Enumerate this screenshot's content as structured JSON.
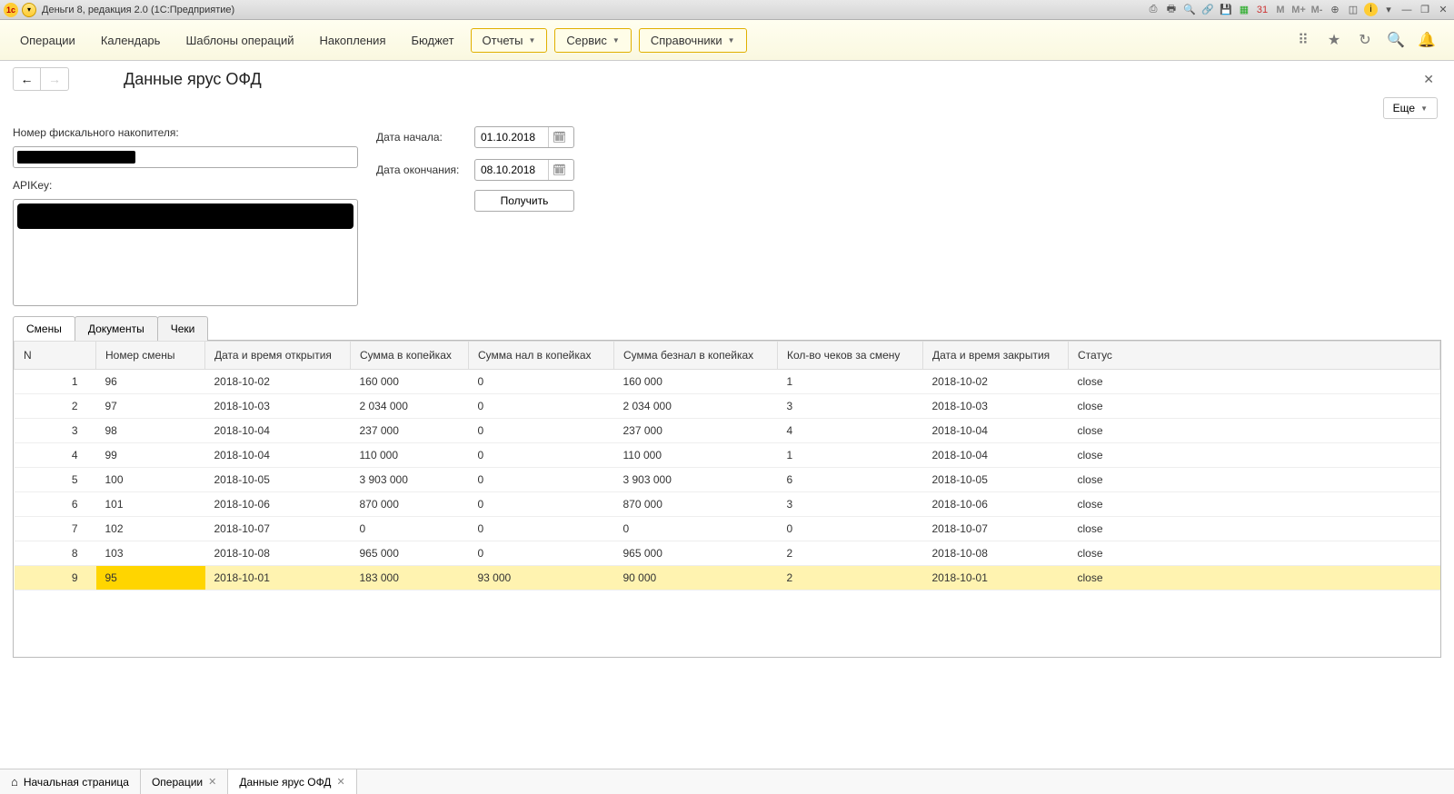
{
  "window_title": "Деньги 8, редакция 2.0  (1С:Предприятие)",
  "titlebar_icons": [
    "M",
    "M+",
    "M-"
  ],
  "menu": {
    "items": [
      "Операции",
      "Календарь",
      "Шаблоны операций",
      "Накопления",
      "Бюджет"
    ],
    "buttons": [
      "Отчеты",
      "Сервис",
      "Справочники"
    ]
  },
  "page_title": "Данные ярус ОФД",
  "more_label": "Еще",
  "form": {
    "fiscal_label": "Номер фискального накопителя:",
    "apikey_label": "APIKey:",
    "date_start_label": "Дата начала:",
    "date_end_label": "Дата окончания:",
    "date_start": "01.10.2018",
    "date_end": "08.10.2018",
    "get_button": "Получить"
  },
  "tabs": [
    "Смены",
    "Документы",
    "Чеки"
  ],
  "active_tab": 0,
  "table": {
    "headers": [
      "N",
      "Номер смены",
      "Дата и время открытия",
      "Сумма в копейках",
      "Сумма нал в копейках",
      "Сумма безнал в копейках",
      "Кол-во чеков за смену",
      "Дата и время закрытия",
      "Статус"
    ],
    "rows": [
      {
        "n": "1",
        "shift": "96",
        "open": "2018-10-02",
        "sum": "160 000",
        "cash": "0",
        "noncash": "160 000",
        "cnt": "1",
        "close": "2018-10-02",
        "status": "close"
      },
      {
        "n": "2",
        "shift": "97",
        "open": "2018-10-03",
        "sum": "2 034 000",
        "cash": "0",
        "noncash": "2 034 000",
        "cnt": "3",
        "close": "2018-10-03",
        "status": "close"
      },
      {
        "n": "3",
        "shift": "98",
        "open": "2018-10-04",
        "sum": "237 000",
        "cash": "0",
        "noncash": "237 000",
        "cnt": "4",
        "close": "2018-10-04",
        "status": "close"
      },
      {
        "n": "4",
        "shift": "99",
        "open": "2018-10-04",
        "sum": "110 000",
        "cash": "0",
        "noncash": "110 000",
        "cnt": "1",
        "close": "2018-10-04",
        "status": "close"
      },
      {
        "n": "5",
        "shift": "100",
        "open": "2018-10-05",
        "sum": "3 903 000",
        "cash": "0",
        "noncash": "3 903 000",
        "cnt": "6",
        "close": "2018-10-05",
        "status": "close"
      },
      {
        "n": "6",
        "shift": "101",
        "open": "2018-10-06",
        "sum": "870 000",
        "cash": "0",
        "noncash": "870 000",
        "cnt": "3",
        "close": "2018-10-06",
        "status": "close"
      },
      {
        "n": "7",
        "shift": "102",
        "open": "2018-10-07",
        "sum": "0",
        "cash": "0",
        "noncash": "0",
        "cnt": "0",
        "close": "2018-10-07",
        "status": "close"
      },
      {
        "n": "8",
        "shift": "103",
        "open": "2018-10-08",
        "sum": "965 000",
        "cash": "0",
        "noncash": "965 000",
        "cnt": "2",
        "close": "2018-10-08",
        "status": "close"
      },
      {
        "n": "9",
        "shift": "95",
        "open": "2018-10-01",
        "sum": "183 000",
        "cash": "93 000",
        "noncash": "90 000",
        "cnt": "2",
        "close": "2018-10-01",
        "status": "close",
        "selected": true
      }
    ]
  },
  "bottom_tabs": [
    {
      "label": "Начальная страница",
      "home": true
    },
    {
      "label": "Операции",
      "closable": true
    },
    {
      "label": "Данные ярус ОФД",
      "closable": true,
      "active": true
    }
  ]
}
